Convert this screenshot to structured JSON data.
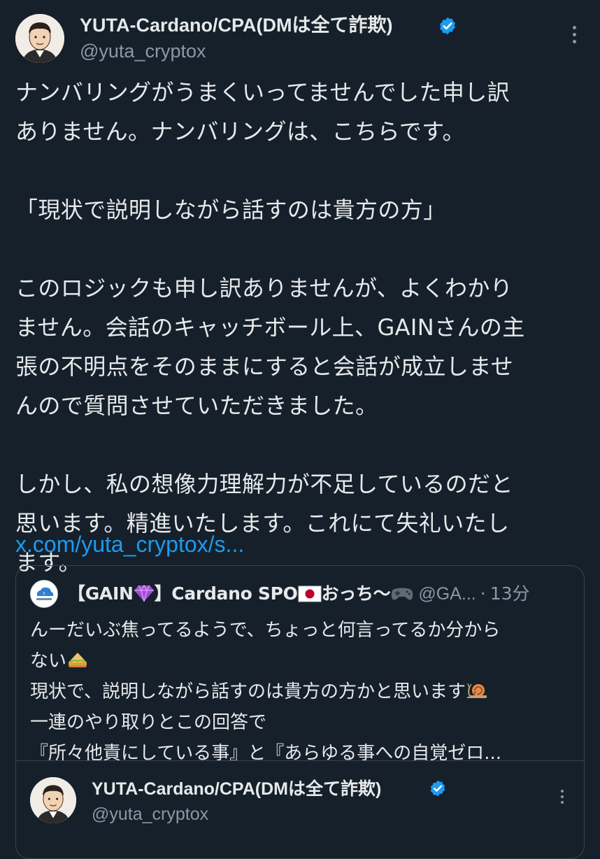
{
  "tweet": {
    "author_name": "YUTA-Cardano/CPA(DMは全て詐欺)",
    "author_handle": "@yuta_cryptox",
    "verified": true,
    "body_lines": [
      "ナンバリングがうまくいってませんでした申し訳",
      "ありません。ナンバリングは、こちらです。",
      "",
      "「現状で説明しながら話すのは貴方の方」",
      "",
      "このロジックも申し訳ありませんが、よくわかり",
      "ません。会話のキャッチボール上、GAINさんの主",
      "張の不明点をそのままにすると会話が成立しませ",
      "んので質問させていただきました。",
      "",
      "しかし、私の想像力理解力が不足しているのだと",
      "思います。精進いたします。これにて失礼いたし",
      "ます。"
    ],
    "link_text": "x.com/yuta_cryptox/s...",
    "more_icon": "more-vertical-icon"
  },
  "quoted": {
    "name_prefix": "【GAIN",
    "name_mid": "】Cardano SPO",
    "name_suffix": "おっち〜",
    "handle": "@GA...",
    "separator": "·",
    "time": "13分",
    "icons": [
      "gem-emoji-icon",
      "japan-flag-icon",
      "gamepad-icon",
      "sandwich-emoji-icon",
      "snail-emoji-icon"
    ],
    "body_lines": [
      "んーだいぶ焦ってるようで、ちょっと何言ってるか分から",
      "ない",
      "現状で、説明しながら話すのは貴方の方かと思います",
      "一連のやり取りとこの回答で",
      "『所々他責にしている事』と『あらゆる事への自覚ゼロ..."
    ]
  },
  "nested": {
    "author_name": "YUTA-Cardano/CPA(DMは全て詐欺)",
    "author_handle": "@yuta_cryptox",
    "verified": true
  },
  "colors": {
    "background": "#15202b",
    "text_primary": "#e7e9ea",
    "text_secondary": "#8b98a5",
    "link": "#1d9bf0",
    "border": "#38444d",
    "verified_badge": "#1d9bf0"
  }
}
